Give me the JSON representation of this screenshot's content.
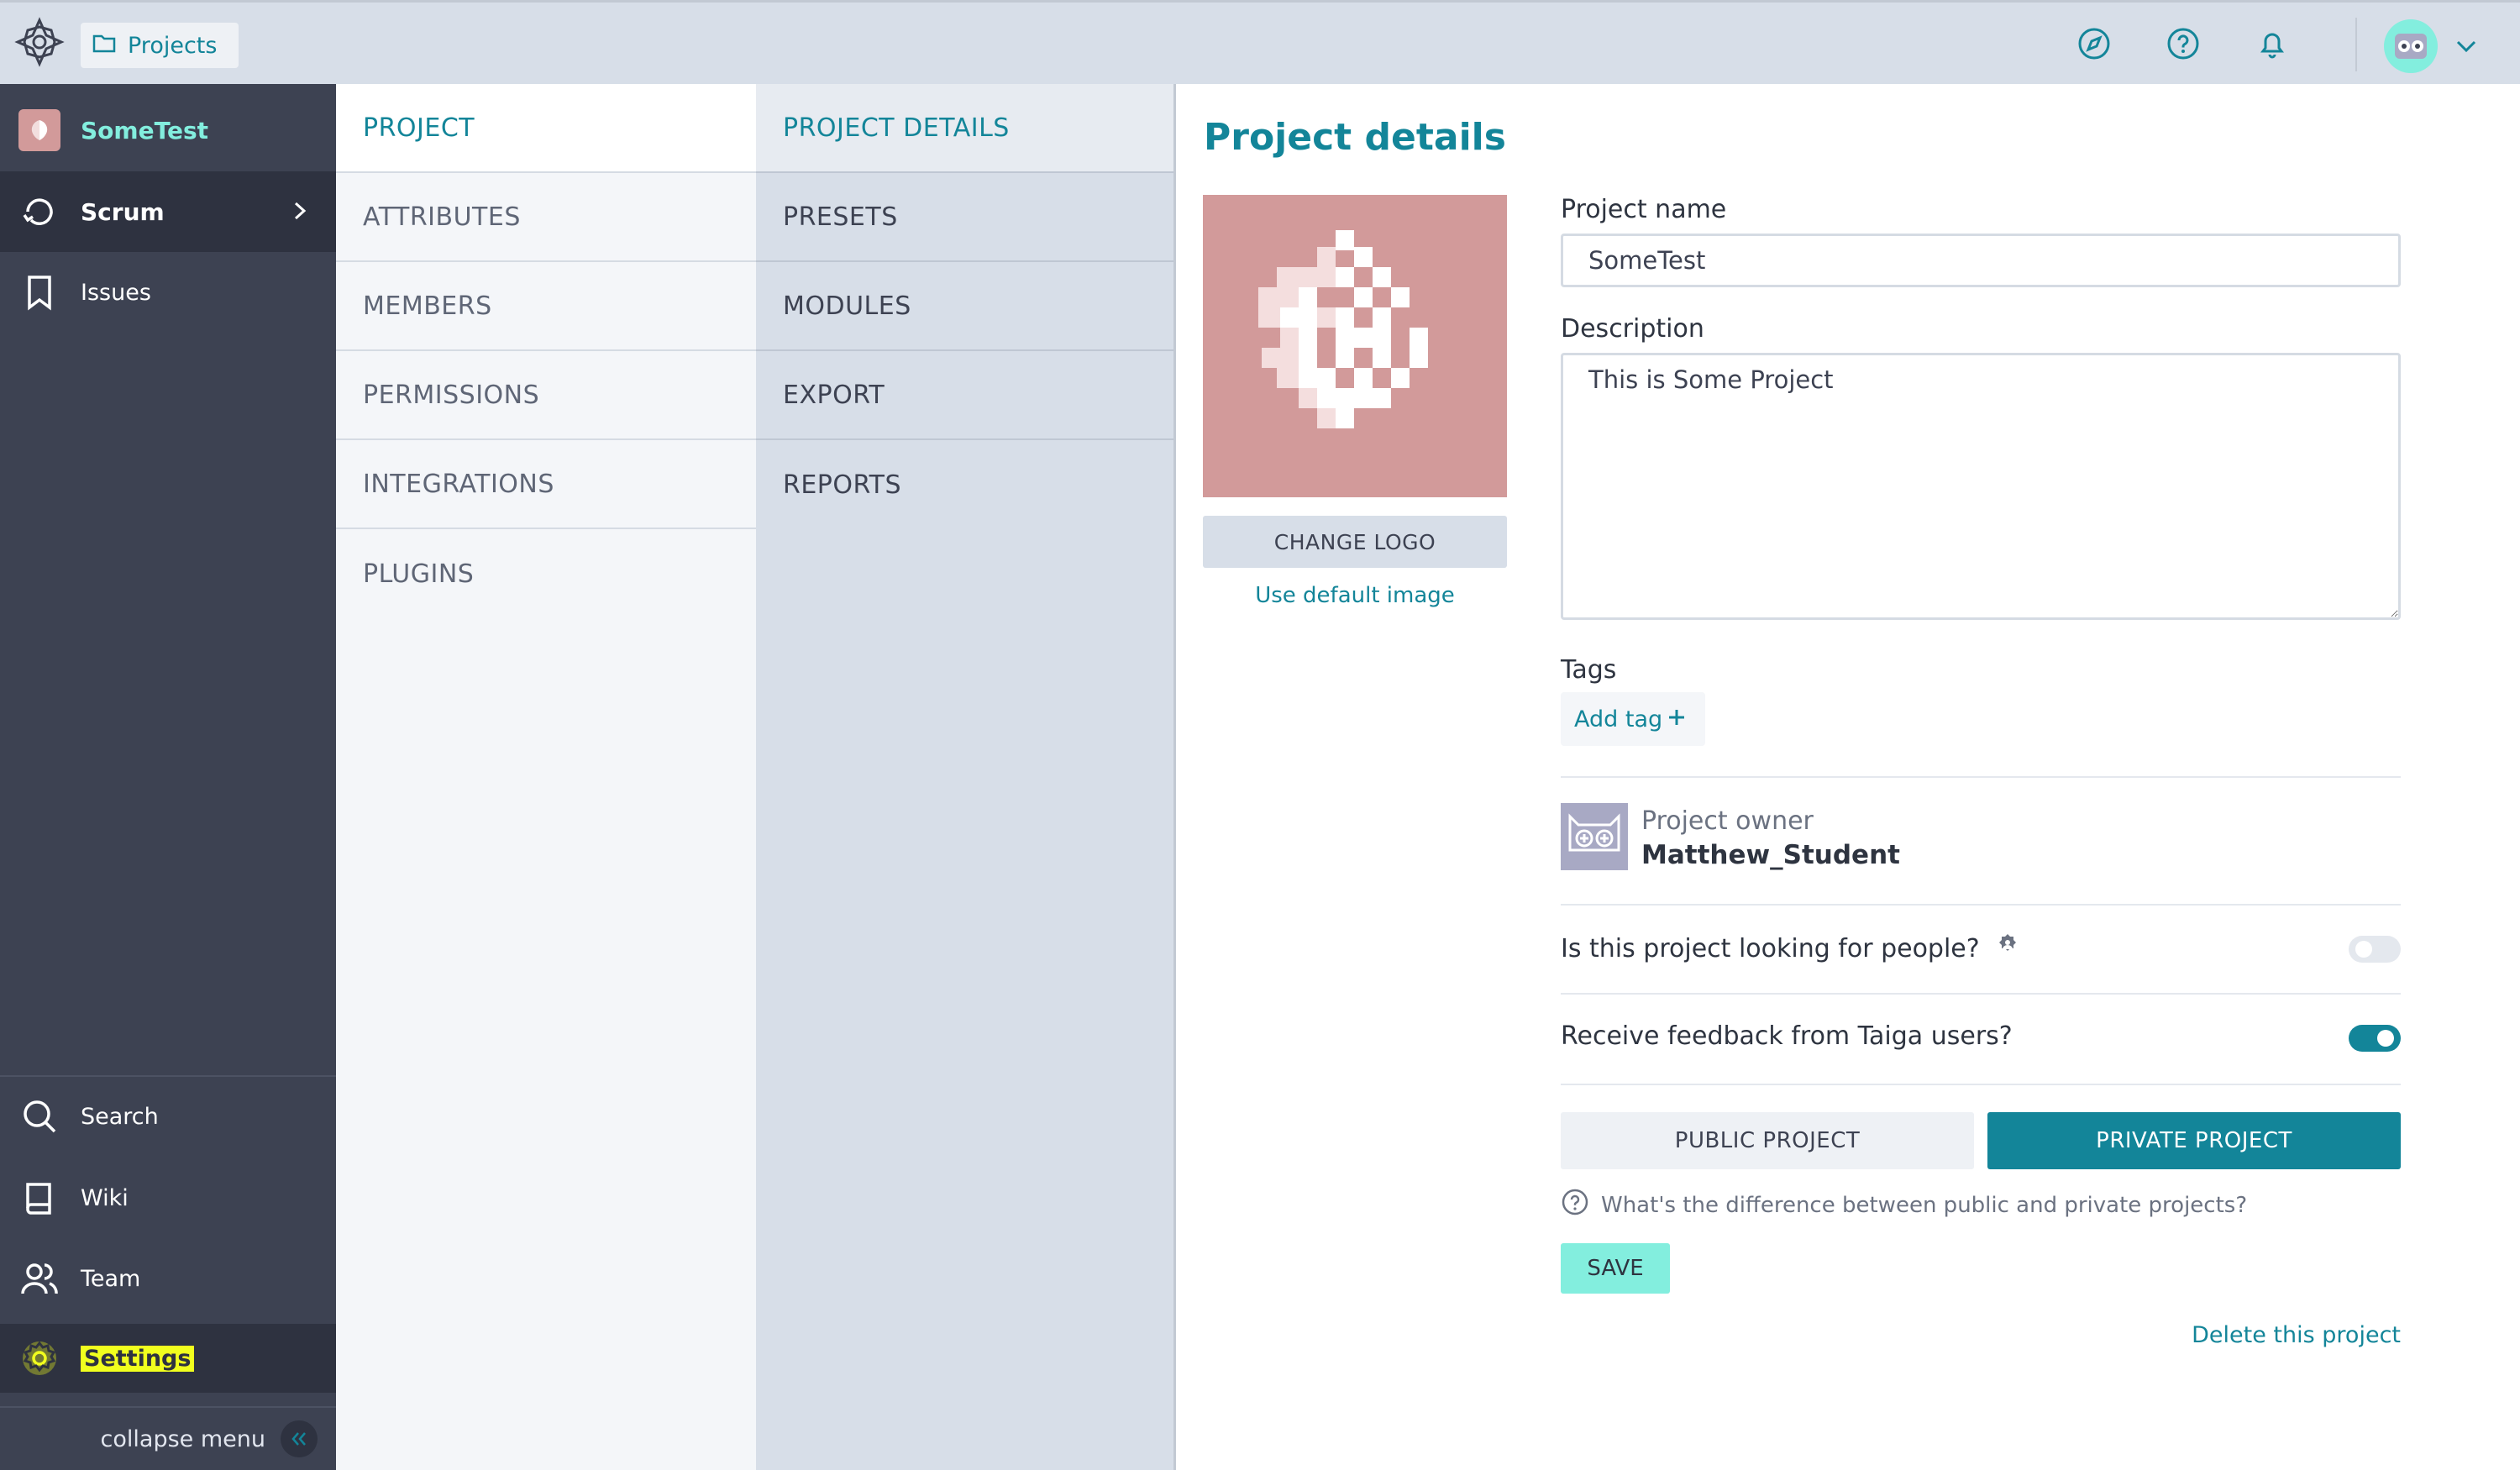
{
  "topbar": {
    "breadcrumb_label": "Projects",
    "icons": [
      "compass-icon",
      "help-icon",
      "bell-icon"
    ],
    "avatar_icon": "owl-avatar"
  },
  "sidebar": {
    "project_name": "SomeTest",
    "scrum_label": "Scrum",
    "issues_label": "Issues",
    "search_label": "Search",
    "wiki_label": "Wiki",
    "team_label": "Team",
    "settings_label": "Settings",
    "collapse_label": "collapse menu"
  },
  "settings_menu": {
    "primary": [
      "PROJECT",
      "ATTRIBUTES",
      "MEMBERS",
      "PERMISSIONS",
      "INTEGRATIONS",
      "PLUGINS"
    ],
    "secondary": [
      "PROJECT DETAILS",
      "PRESETS",
      "MODULES",
      "EXPORT",
      "REPORTS"
    ]
  },
  "main": {
    "title": "Project details",
    "change_logo": "CHANGE LOGO",
    "use_default": "Use default image",
    "project_name_label": "Project name",
    "project_name_value": "SomeTest",
    "description_label": "Description",
    "description_value": "This is Some Project",
    "tags_label": "Tags",
    "add_tag": "Add tag",
    "owner_label": "Project owner",
    "owner_name": "Matthew_Student",
    "looking_for_people": "Is this project looking for people?",
    "looking_for_people_enabled": false,
    "receive_feedback": "Receive feedback from Taiga users?",
    "receive_feedback_enabled": true,
    "public_project": "PUBLIC PROJECT",
    "private_project": "PRIVATE PROJECT",
    "difference_link": "What's the difference between public and private projects?",
    "save": "SAVE",
    "delete_project": "Delete this project"
  },
  "colors": {
    "accent": "#138599",
    "mint": "#83eede",
    "sidebar_bg": "#3d4252",
    "project_logo_bg": "#d29a9a",
    "settings_highlight": "#f1ff1e"
  }
}
